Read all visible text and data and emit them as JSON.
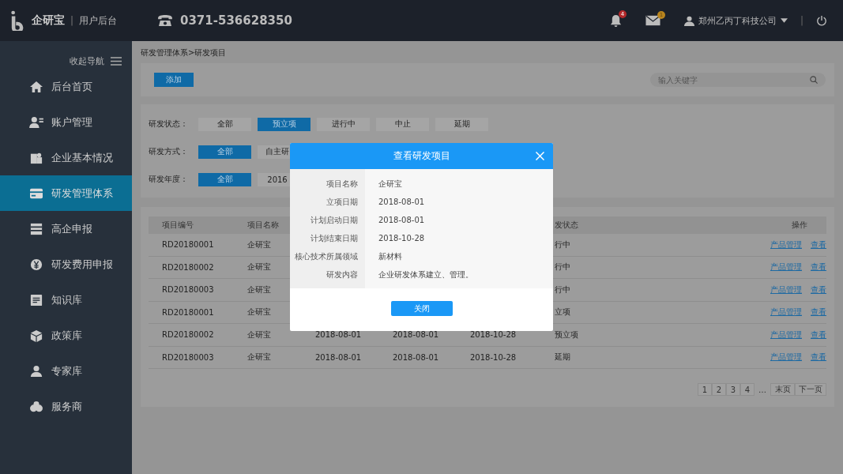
{
  "header": {
    "brand": "企研宝",
    "separator": "|",
    "subtitle": "用户后台",
    "phone": "0371-536628350",
    "notifications": {
      "badge": "4"
    },
    "messages": {
      "badge": "1"
    },
    "company": "郑州乙丙丁科技公司",
    "divider": "|"
  },
  "sidebar": {
    "collapse_label": "收起导航",
    "items": [
      {
        "label": "后台首页",
        "selected": false
      },
      {
        "label": "账户管理",
        "selected": false
      },
      {
        "label": "企业基本情况",
        "selected": false
      },
      {
        "label": "研发管理体系",
        "selected": true
      },
      {
        "label": "高企申报",
        "selected": false
      },
      {
        "label": "研发费用申报",
        "selected": false
      },
      {
        "label": "知识库",
        "selected": false
      },
      {
        "label": "政策库",
        "selected": false
      },
      {
        "label": "专家库",
        "selected": false
      },
      {
        "label": "服务商",
        "selected": false
      }
    ]
  },
  "breadcrumb": "研发管理体系>研发项目",
  "toolbar": {
    "add_button": "添加",
    "search": {
      "placeholder": "输入关键字"
    }
  },
  "filters": [
    {
      "label": "研发状态：",
      "options": [
        {
          "label": "全部",
          "selected": false
        },
        {
          "label": "预立项",
          "selected": true
        },
        {
          "label": "进行中",
          "selected": false
        },
        {
          "label": "中止",
          "selected": false
        },
        {
          "label": "延期",
          "selected": false
        }
      ]
    },
    {
      "label": "研发方式：",
      "options": [
        {
          "label": "全部",
          "selected": true
        },
        {
          "label": "自主研",
          "selected": false
        }
      ]
    },
    {
      "label": "研发年度：",
      "options": [
        {
          "label": "全部",
          "selected": true
        },
        {
          "label": "2016",
          "selected": false
        }
      ]
    }
  ],
  "table": {
    "columns": [
      "项目编号",
      "项目名称",
      "",
      "",
      "",
      "发状态",
      "操作"
    ],
    "rows": [
      {
        "id": "RD20180001",
        "name": "企研宝",
        "status": "行中",
        "actions": [
          "产品管理",
          "查看"
        ]
      },
      {
        "id": "RD20180002",
        "name": "企研宝",
        "status": "行中",
        "actions": [
          "产品管理",
          "查看"
        ]
      },
      {
        "id": "RD20180003",
        "name": "企研宝",
        "status": "行中",
        "actions": [
          "产品管理",
          "查看"
        ]
      },
      {
        "id": "RD20180001",
        "name": "企研宝",
        "status": "立项",
        "actions": [
          "产品管理",
          "查看"
        ]
      },
      {
        "id": "RD20180002",
        "name": "企研宝",
        "column_3": "2018-08-01",
        "column_4": "2018-08-01",
        "column_5": "2018-10-28",
        "status": "预立项",
        "actions": [
          "产品管理",
          "查看"
        ]
      },
      {
        "id": "RD20180003",
        "name": "企研宝",
        "column_3": "2018-08-01",
        "column_4": "2018-08-01",
        "column_5": "2018-10-28",
        "status": "延期",
        "actions": [
          "产品管理",
          "查看"
        ]
      }
    ]
  },
  "pagination": {
    "pages": [
      {
        "label": "1",
        "selected": false
      },
      {
        "label": "2",
        "selected": false
      },
      {
        "label": "3",
        "selected": false
      },
      {
        "label": "4",
        "selected": false
      }
    ],
    "ellipsis": "…",
    "last": "末页",
    "next": "下一页"
  },
  "dialog": {
    "title": "查看研发项目",
    "fields": [
      {
        "label": "项目名称",
        "value": "企研宝"
      },
      {
        "label": "立项日期",
        "value": "2018-08-01"
      },
      {
        "label": "计划启动日期",
        "value": "2018-08-01"
      },
      {
        "label": "计划结束日期",
        "value": "2018-10-28"
      },
      {
        "label": "核心技术所属领域",
        "value": "新材料"
      },
      {
        "label": "研发内容",
        "value": "企业研发体系建立、管理。"
      }
    ],
    "close_button": "关闭"
  }
}
